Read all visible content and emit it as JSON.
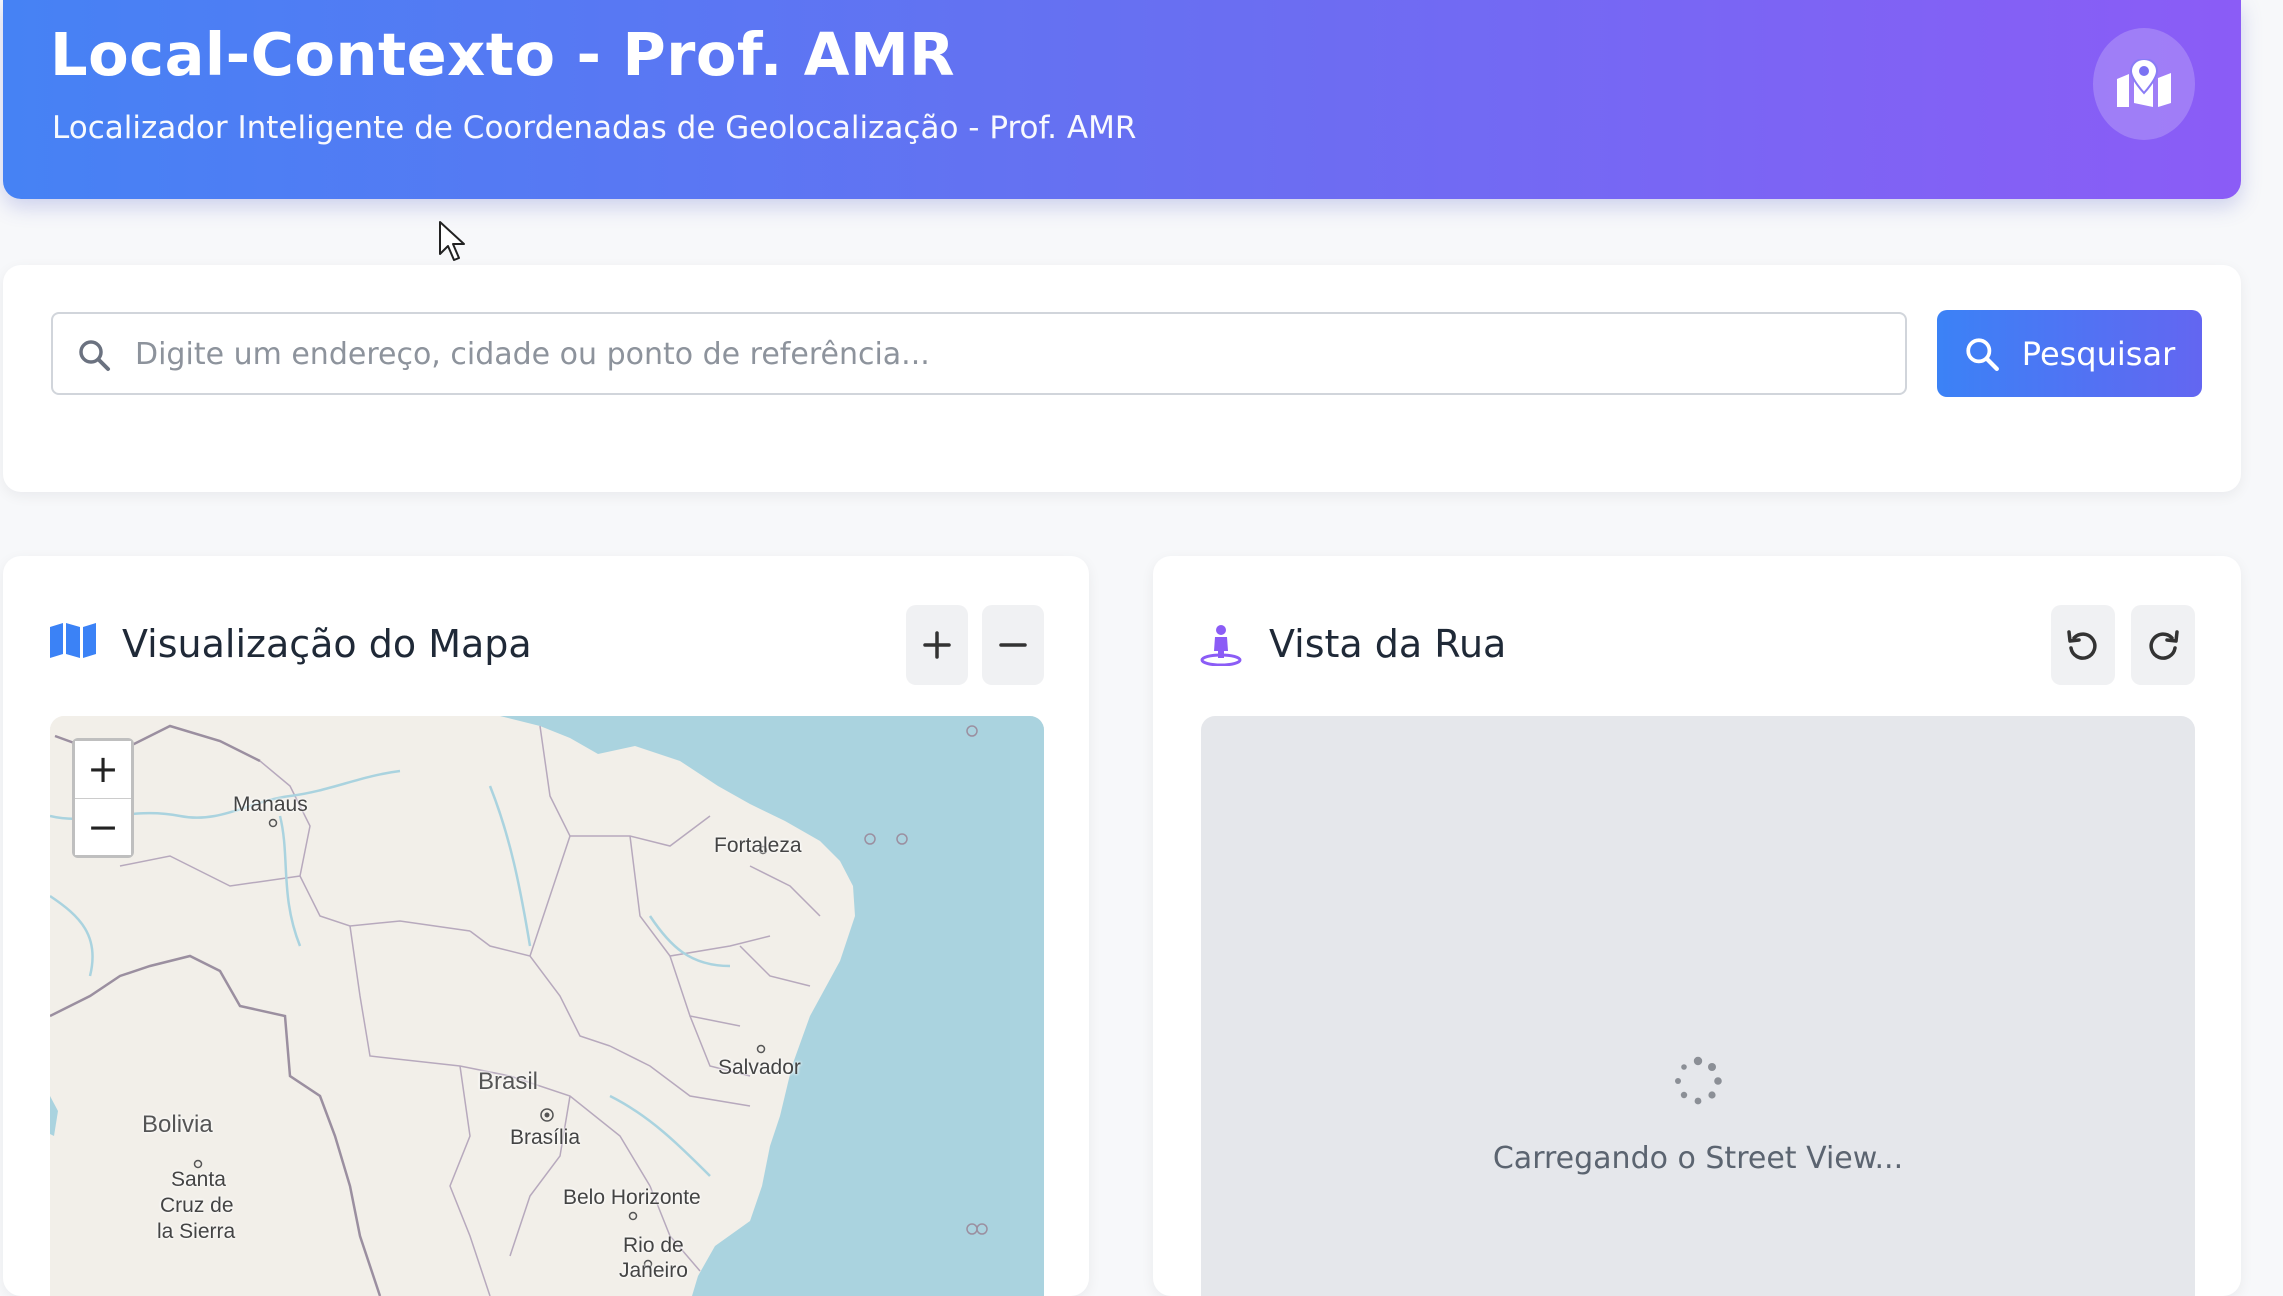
{
  "header": {
    "title": "Local-Contexto - Prof. AMR",
    "subtitle": "Localizador Inteligente de Coordenadas de Geolocalização - Prof. AMR",
    "icon": "map-marked-icon"
  },
  "search": {
    "placeholder": "Digite um endereço, cidade ou ponto de referência...",
    "value": "",
    "button_label": "Pesquisar"
  },
  "map_panel": {
    "title": "Visualização do Mapa",
    "icon": "folded-map-icon",
    "controls": [
      "zoom-in",
      "zoom-out"
    ],
    "leaflet_zoom": [
      "+",
      "−"
    ],
    "labels": {
      "manaus": "Manaus",
      "fortaleza": "Fortaleza",
      "brasil": "Brasil",
      "salvador": "Salvador",
      "bolivia": "Bolivia",
      "brasilia": "Brasília",
      "santa_cruz_1": "Santa",
      "santa_cruz_2": "Cruz de",
      "santa_cruz_3": "la Sierra",
      "belo_horizonte": "Belo Horizonte",
      "rio_1": "Rio de",
      "rio_2": "Janeiro"
    },
    "colors": {
      "land": "#f2efe9",
      "sea": "#aad3df",
      "border": "#9b8fa0"
    }
  },
  "street_panel": {
    "title": "Vista da Rua",
    "icon": "street-view-icon",
    "loading_text": "Carregando o Street View...",
    "accent": "#8b5cf6"
  },
  "colors": {
    "primary": "#3b82f6",
    "secondary": "#8b5cf6"
  }
}
